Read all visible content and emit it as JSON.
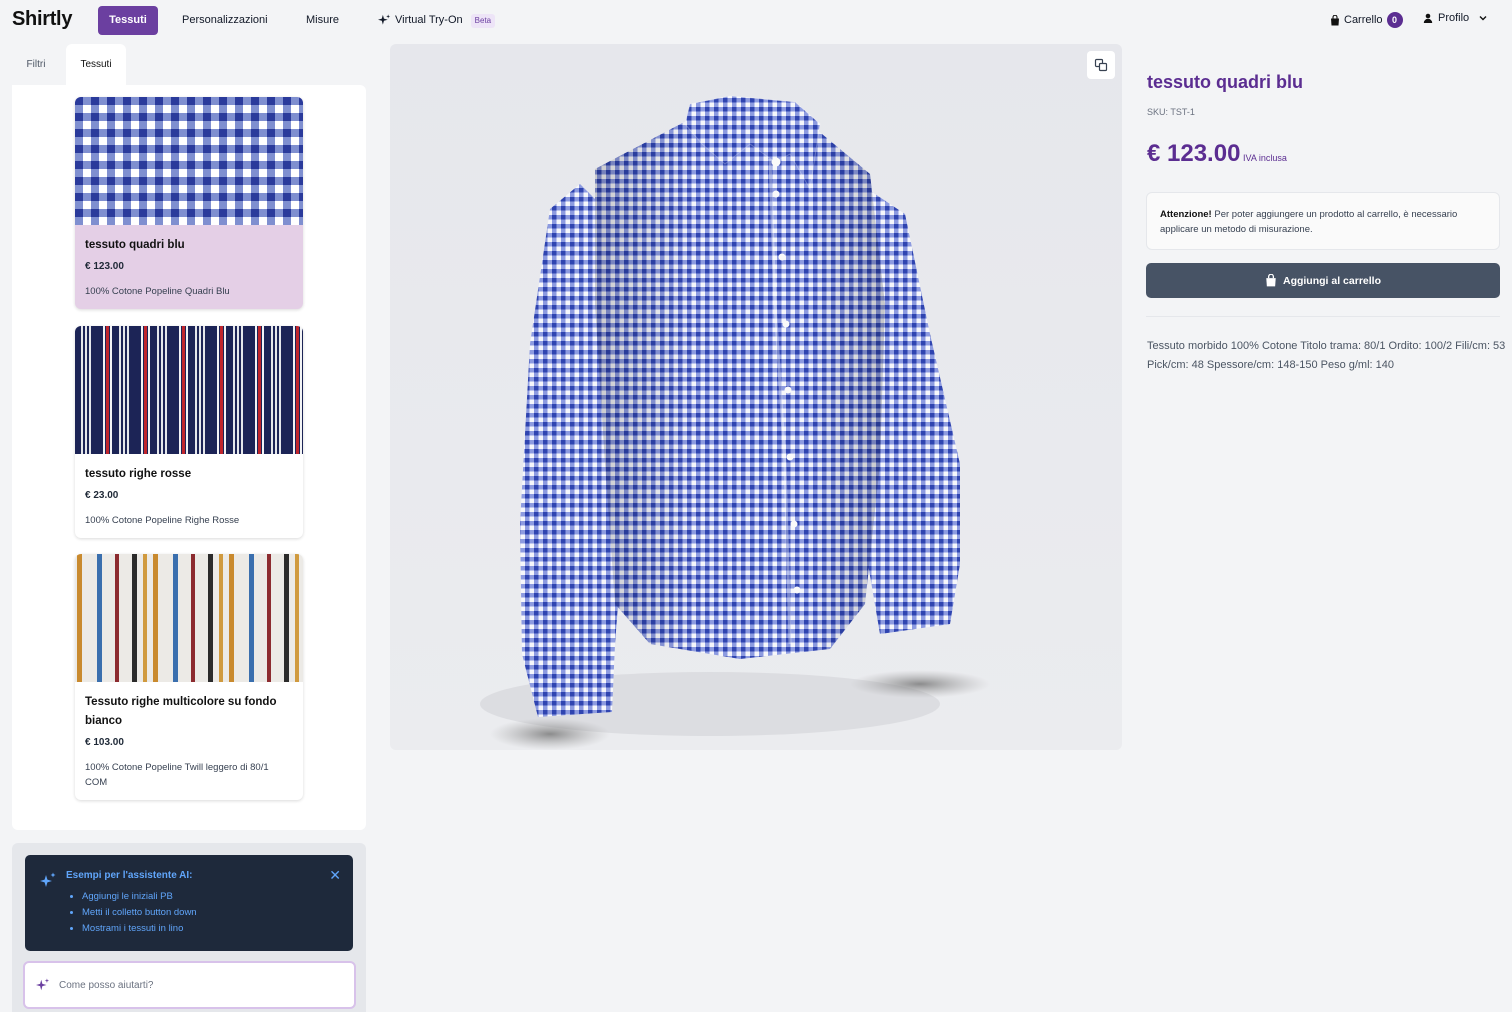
{
  "brand": "Shirtly",
  "nav": {
    "tessuti": "Tessuti",
    "personalizzazioni": "Personalizzazioni",
    "misure": "Misure",
    "virtual_try_on": "Virtual Try-On",
    "beta": "Beta",
    "cart_label": "Carrello",
    "cart_count": "0",
    "profile_label": "Profilo"
  },
  "left_tabs": {
    "filtri": "Filtri",
    "tessuti": "Tessuti"
  },
  "fabrics": [
    {
      "name": "tessuto quadri blu",
      "price": "€ 123.00",
      "desc": "100% Cotone Popeline Quadri Blu",
      "selected": true
    },
    {
      "name": "tessuto righe rosse",
      "price": "€ 23.00",
      "desc": "100% Cotone Popeline Righe Rosse",
      "selected": false
    },
    {
      "name": "Tessuto righe multicolore su fondo bianco",
      "price": "€ 103.00",
      "desc": "100% Cotone Popeline Twill leggero di 80/1 COM",
      "selected": false
    }
  ],
  "ai": {
    "title": "Esempi per l'assistente AI:",
    "examples": [
      "Aggiungi le iniziali PB",
      "Metti il colletto button down",
      "Mostrami i tessuti in lino"
    ],
    "placeholder": "Come posso aiutarti?"
  },
  "product": {
    "title": "tessuto quadri blu",
    "sku": "SKU: TST-1",
    "price": "€ 123.00",
    "iva": "IVA inclusa",
    "alert_bold": "Attenzione!",
    "alert_text": " Per poter aggiungere un prodotto al carrello, è necessario applicare un metodo di misurazione.",
    "add_to_cart": "Aggiungi al carrello",
    "description": "Tessuto morbido 100% Cotone Titolo trama: 80/1 Ordito: 100/2 Fili/cm: 53 Pick/cm: 48 Spessore/cm: 148-150 Peso g/ml: 140"
  },
  "colors": {
    "accent": "#5b2d91",
    "nav_active": "#6b3fa0",
    "button_dark": "#475365",
    "ai_box": "#1e293b"
  },
  "icons": [
    "sparkle-icon",
    "bag-icon",
    "user-icon",
    "chevron-down-icon",
    "close-icon",
    "copy-icon"
  ]
}
